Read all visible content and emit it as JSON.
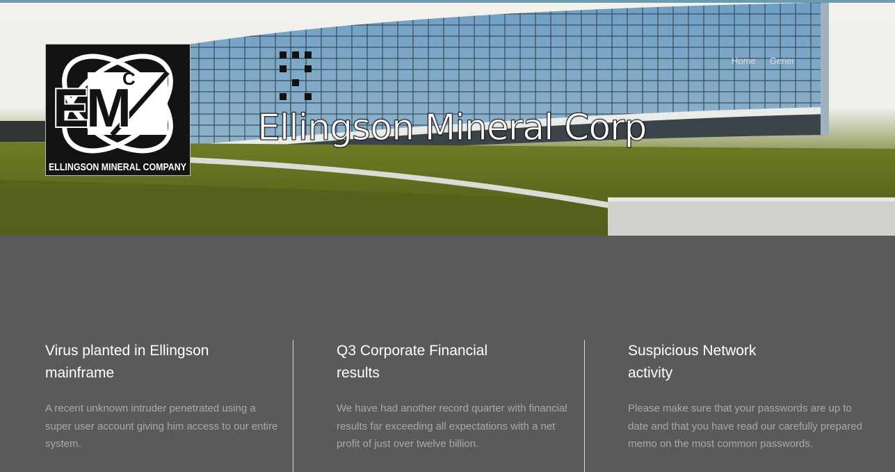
{
  "header": {
    "title": "Ellingson Mineral Corp",
    "logo": {
      "letters_large": "EM",
      "letter_small": "C",
      "caption": "ELLINGSON MINERAL COMPANY"
    },
    "nav": [
      {
        "label": "Home"
      },
      {
        "label": "General"
      }
    ],
    "accent_color": "#6a9cb0"
  },
  "articles": [
    {
      "title": "Virus planted in Ellingson mainframe",
      "body": "A recent unknown intruder penetrated using a super user account giving him access to our entire system."
    },
    {
      "title": "Q3 Corporate Financial results",
      "body": "We have had another record quarter with financial results far exceeding all expectations with a net profit of just over twelve billion."
    },
    {
      "title": "Suspicious Network activity",
      "body": "Please make sure that your passwords are up to date and that you have read our carefully prepared memo on the most common passwords."
    }
  ]
}
